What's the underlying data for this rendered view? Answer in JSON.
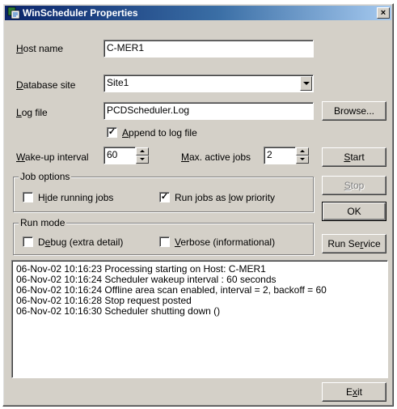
{
  "window": {
    "title": "WinScheduler Properties",
    "close_glyph": "×"
  },
  "icons": {
    "app": "scheduler-app-icon",
    "close": "close-icon"
  },
  "host": {
    "label_prefix": "",
    "label_ul": "H",
    "label_rest": "ost name",
    "value": "C-MER1"
  },
  "database": {
    "label_ul": "D",
    "label_rest": "atabase site",
    "value": "Site1"
  },
  "logfile": {
    "label_ul": "L",
    "label_rest": "og file",
    "value": "PCDScheduler.Log",
    "browse_label": "Browse..."
  },
  "append": {
    "checked_glyph": "✓",
    "label_ul": "A",
    "label_rest": "ppend to log file"
  },
  "wakeup": {
    "label_ul": "W",
    "label_rest": "ake-up interval",
    "value": "60"
  },
  "maxjobs": {
    "label_ul": "M",
    "label_rest": "ax. active jobs",
    "value": "2"
  },
  "buttons": {
    "start_ul": "S",
    "start_rest": "tart",
    "stop_ul": "S",
    "stop_rest": "top",
    "ok": "OK",
    "run_service_pre": "Run Se",
    "run_service_ul": "r",
    "run_service_post": "vice",
    "exit_pre": "E",
    "exit_ul": "x",
    "exit_post": "it"
  },
  "job_options": {
    "title": "Job options",
    "hide_pre": "H",
    "hide_ul": "i",
    "hide_post": "de running jobs",
    "lowprio_pre": "Run jobs as ",
    "lowprio_ul": "l",
    "lowprio_post": "ow priority",
    "lowprio_glyph": "✓"
  },
  "run_mode": {
    "title": "Run mode",
    "debug_pre": "D",
    "debug_ul": "e",
    "debug_post": "bug (extra detail)",
    "verbose_ul": "V",
    "verbose_post": "erbose (informational)"
  },
  "log_lines": [
    "06-Nov-02 10:16:23 Processing starting on Host: C-MER1",
    "06-Nov-02 10:16:24 Scheduler wakeup interval : 60 seconds",
    "06-Nov-02 10:16:24 Offline area scan enabled, interval = 2, backoff = 60",
    "06-Nov-02 10:16:28 Stop request posted",
    "06-Nov-02 10:16:30 Scheduler shutting down ()"
  ]
}
